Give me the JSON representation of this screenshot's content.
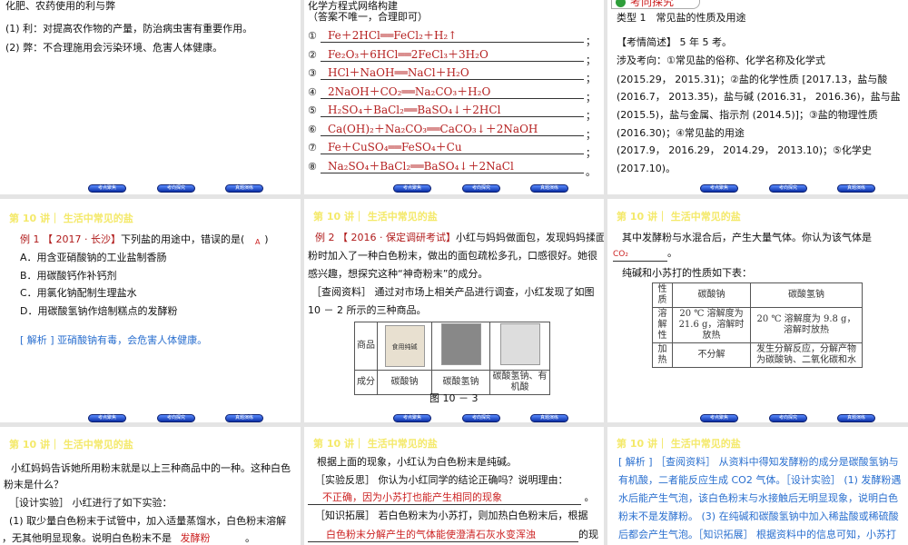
{
  "nav": [
    "考点聚焦",
    "考向探究",
    "真题演练"
  ],
  "header": "第 10 讲｜ 生活中常见的盐",
  "s1": {
    "title": "化肥、农药使用的利与弊",
    "lines": [
      "(1) 利：对提高农作物的产量，防治病虫害有重要作用。",
      "(2) 弊：不合理施用会污染环境、危害人体健康。"
    ]
  },
  "s2": {
    "title": "化学方程式网络构建",
    "sub": "（答案不唯一，合理即可）",
    "equations": [
      {
        "n": "①",
        "f": "Fe＋2HCl══FeCl₂＋H₂↑",
        "p": "；"
      },
      {
        "n": "②",
        "f": "Fe₂O₃＋6HCl══2FeCl₃＋3H₂O",
        "p": "；"
      },
      {
        "n": "③",
        "f": "HCl＋NaOH══NaCl＋H₂O",
        "p": "；"
      },
      {
        "n": "④",
        "f": "2NaOH＋CO₂══Na₂CO₃＋H₂O",
        "p": "；"
      },
      {
        "n": "⑤",
        "f": "H₂SO₄＋BaCl₂══BaSO₄↓＋2HCl",
        "p": "；"
      },
      {
        "n": "⑥",
        "f": "Ca(OH)₂＋Na₂CO₃══CaCO₃↓＋2NaOH",
        "p": "；"
      },
      {
        "n": "⑦",
        "f": "Fe＋CuSO₄══FeSO₄＋Cu",
        "p": "；"
      },
      {
        "n": "⑧",
        "f": "Na₂SO₄＋BaCl₂══BaSO₄↓＋2NaCl",
        "p": "。"
      }
    ]
  },
  "s3": {
    "badge": "考向探究",
    "type": "类型 1　常见盐的性质及用途",
    "lines": [
      "【考情简述】 5 年 5 考。",
      "涉及考向：①常见盐的俗称、化学名称及化学式",
      "(2015.29， 2015.31)；②盐的化学性质 [2017.13，盐与酸",
      "(2016.7， 2013.35)，盐与碱 (2016.31， 2016.36)，盐与盐",
      "(2015.5)，盐与金属、指示剂 (2014.5)]；③盐的物理性质",
      "(2016.30)；④常见盐的用途",
      "(2017.9， 2016.29， 2014.29， 2013.10)；⑤化学史",
      "(2017.10)。"
    ]
  },
  "s4": {
    "q_prefix": "例 1 【 2017 · 长沙】",
    "q": "下列盐的用途中，错误的是(　　)",
    "answer": "A",
    "options": [
      "A．用含亚硝酸钠的工业盐制香肠",
      "B．用碳酸钙作补钙剂",
      "C．用氯化钠配制生理盐水",
      "D．用碳酸氢钠作焙制糕点的发酵粉"
    ],
    "analysis": "[ 解析 ]  亚硝酸钠有毒，会危害人体健康。"
  },
  "s5": {
    "q_prefix": "例 2 【 2016 · 保定调研考试】",
    "lines": [
      "小红与妈妈做面包，发现妈妈揉面",
      "粉时加入了一种白色粉末，做出的面包疏松多孔，口感很好。她很",
      "感兴趣，想探究这种“神奇粉末”的成分。",
      "［查阅资料］ 通过对市场上相关产品进行调查，小红发现了如图",
      "10 － 2 所示的三种商品。"
    ],
    "table": {
      "row1": "商品",
      "row2": "成分",
      "items": [
        "碳酸钠",
        "碳酸氢钠",
        "碳酸氢钠、有机酸"
      ],
      "product_label": "食用纯碱"
    },
    "caption": "图 10 － 3"
  },
  "s6": {
    "line1": "其中发酵粉与水混合后，产生大量气体。你认为该气体是",
    "answer": "CO₂",
    "period": "。",
    "line2": "纯碱和小苏打的性质如下表：",
    "table": {
      "headers": [
        "性质",
        "碳酸钠",
        "碳酸氢钠"
      ],
      "rows": [
        [
          "溶解性",
          "20 ℃ 溶解度为 21.6 g，溶解时放热",
          "20 ℃ 溶解度为 9.8 g，溶解时放热"
        ],
        [
          "加热",
          "不分解",
          "发生分解反应，分解产物为碳酸钠、二氧化碳和水"
        ]
      ]
    }
  },
  "s7": {
    "lines": [
      "小红妈妈告诉她所用粉末就是以上三种商品中的一种。这种白色",
      "粉末是什么？",
      "［设计实验］ 小红进行了如下实验：",
      "(1) 取少量白色粉末于试管中，加入适量蒸馏水，白色粉末溶解"
    ],
    "last": "，无其他明显现象。说明白色粉末不是",
    "answer": "发酵粉",
    "period": "。"
  },
  "s8": {
    "lines": [
      "根据上面的现象，小红认为白色粉末是纯碱。",
      "［实验反思］ 你认为小红同学的结论正确吗？说明理由：",
      "［知识拓展］ 若白色粉末为小苏打，则加热白色粉末后，根据"
    ],
    "answer1": "不正确，因为小苏打也能产生相同的现象",
    "answer2": "白色粉末分解产生的气体能使澄清石灰水变浑浊",
    "tail": "的现",
    "period": "。"
  },
  "s9": {
    "lines": [
      "[ 解析 ] ［查阅资料］ 从资料中得知发酵粉的成分是碳酸氢钠与",
      "有机酸，二者能反应生成 CO2 气体。［设计实验］ (1) 发酵粉遇",
      "水后能产生气泡，该白色粉末与水接触后无明显现象，说明白色",
      "粉末不是发酵粉。 (3) 在纯碱和碳酸氢钠中加入稀盐酸或稀硫酸",
      "后都会产生气泡。［知识拓展］ 根据资料中的信息可知，小苏打"
    ]
  }
}
